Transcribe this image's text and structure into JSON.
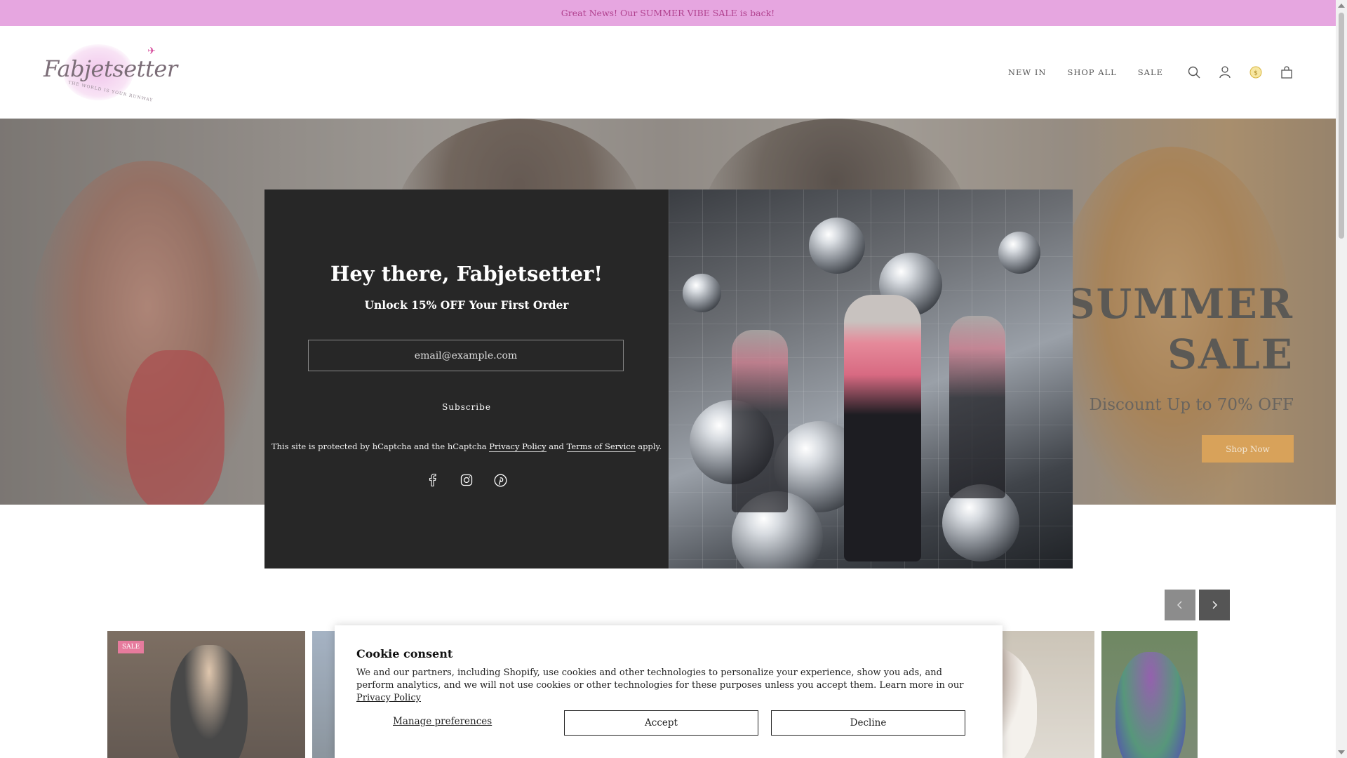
{
  "announcement": {
    "text": "Great News! Our SUMMER VIBE SALE is back!"
  },
  "header": {
    "logo_text": "Fabjetsetter",
    "logo_tagline": "THE WORLD IS YOUR RUNWAY",
    "nav": [
      {
        "label": "NEW IN"
      },
      {
        "label": "SHOP ALL"
      },
      {
        "label": "SALE"
      }
    ],
    "icons": [
      "search-icon",
      "account-icon",
      "currency-icon",
      "bag-icon"
    ]
  },
  "hero": {
    "title_line1": "SUMMER",
    "title_line2": "SALE",
    "subtitle": "Discount Up to 70% OFF",
    "cta": "Shop Now"
  },
  "popup": {
    "heading": "Hey there, Fabjetsetter!",
    "subheading": "Unlock 15% OFF Your First Order",
    "email_placeholder": "email@example.com",
    "subscribe_label": "Subscribe",
    "legal_prefix": "This site is protected by hCaptcha and the hCaptcha",
    "legal_privacy": "Privacy Policy",
    "legal_and": "and",
    "legal_terms": "Terms of Service",
    "legal_suffix": "apply.",
    "social": [
      "facebook-icon",
      "instagram-icon",
      "pinterest-icon"
    ]
  },
  "products": {
    "badge": "SALE"
  },
  "cookie": {
    "title": "Cookie consent",
    "body": "We and our partners, including Shopify, use cookies and other technologies to personalize your experience, show you ads, and perform analytics, and we will not use cookies or other technologies for these purposes unless you accept them. Learn more in our",
    "privacy_link": "Privacy Policy",
    "manage": "Manage preferences",
    "accept": "Accept",
    "decline": "Decline"
  },
  "colors": {
    "announcement_bg": "#e6a6e0",
    "announcement_text": "#b1428f",
    "popup_bg": "#272727",
    "hero_cta": "#d8a25a",
    "sale_badge": "#e05b85"
  }
}
